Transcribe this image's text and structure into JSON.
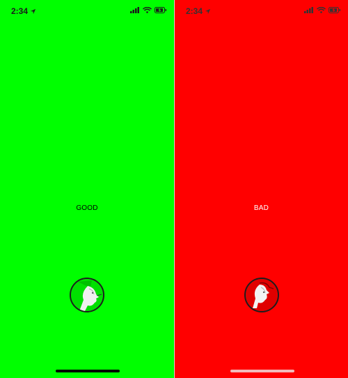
{
  "colors": {
    "good_bg": "#00ff00",
    "bad_bg": "#ff0000"
  },
  "screens": [
    {
      "time": "2:34",
      "label": "GOOD",
      "icons": [
        "location-arrow-icon",
        "signal-icon",
        "wifi-icon",
        "battery-charging-icon"
      ]
    },
    {
      "time": "2:34",
      "label": "BAD",
      "icons": [
        "location-arrow-icon",
        "signal-icon",
        "wifi-icon",
        "battery-charging-icon"
      ]
    }
  ]
}
